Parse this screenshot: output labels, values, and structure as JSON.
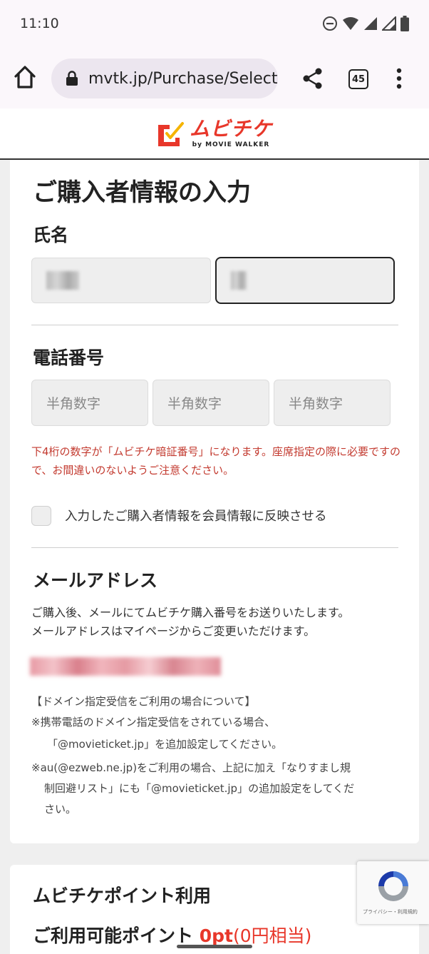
{
  "status_bar": {
    "time": "11:10",
    "icons": [
      "do-not-disturb-icon",
      "wifi-icon",
      "signal-icon",
      "signal-icon",
      "battery-icon"
    ]
  },
  "browser": {
    "url": "mvtk.jp/Purchase/Select",
    "tab_count": "45",
    "icons": [
      "home-icon",
      "lock-icon",
      "share-icon",
      "tabs-icon",
      "more-vert-icon"
    ]
  },
  "site": {
    "brand": "ムビチケ",
    "byline": "by MOVIE WALKER",
    "brand_color": "#e8372a"
  },
  "form": {
    "title": "ご購入者情報の入力",
    "name_label": "氏名",
    "phone_label": "電話番号",
    "phone_placeholders": [
      "半角数字",
      "半角数字",
      "半角数字"
    ],
    "phone_note": "下4桁の数字が「ムビチケ暗証番号」になります。座席指定の際に必要ですので、お間違いのないようご注意ください。",
    "reflect_checkbox_label": "入力したご購入者情報を会員情報に反映させる",
    "email_label": "メールアドレス",
    "email_desc_1": "ご購入後、メールにてムビチケ購入番号をお送りいたします。",
    "email_desc_2": "メールアドレスはマイページからご変更いただけます。",
    "domain_notice": {
      "heading": "【ドメイン指定受信をご利用の場合について】",
      "line1": "※携帯電話のドメイン指定受信をされている場合、",
      "line2": "「@movieticket.jp」を追加設定してください。",
      "line3": "※au(@ezweb.ne.jp)をご利用の場合、上記に加え「なりすまし規",
      "line4": "制回避リスト」にも「@movieticket.jp」の追加設定をしてくだ",
      "line5": "さい。"
    },
    "accent_red": "#c33a2f"
  },
  "points": {
    "title": "ムビチケポイント利用",
    "available_label": "ご利用可能ポイント",
    "points_value": "0pt",
    "points_yen": "(0円相当)"
  },
  "recaptcha": {
    "text": "プライバシー・利用規約"
  }
}
